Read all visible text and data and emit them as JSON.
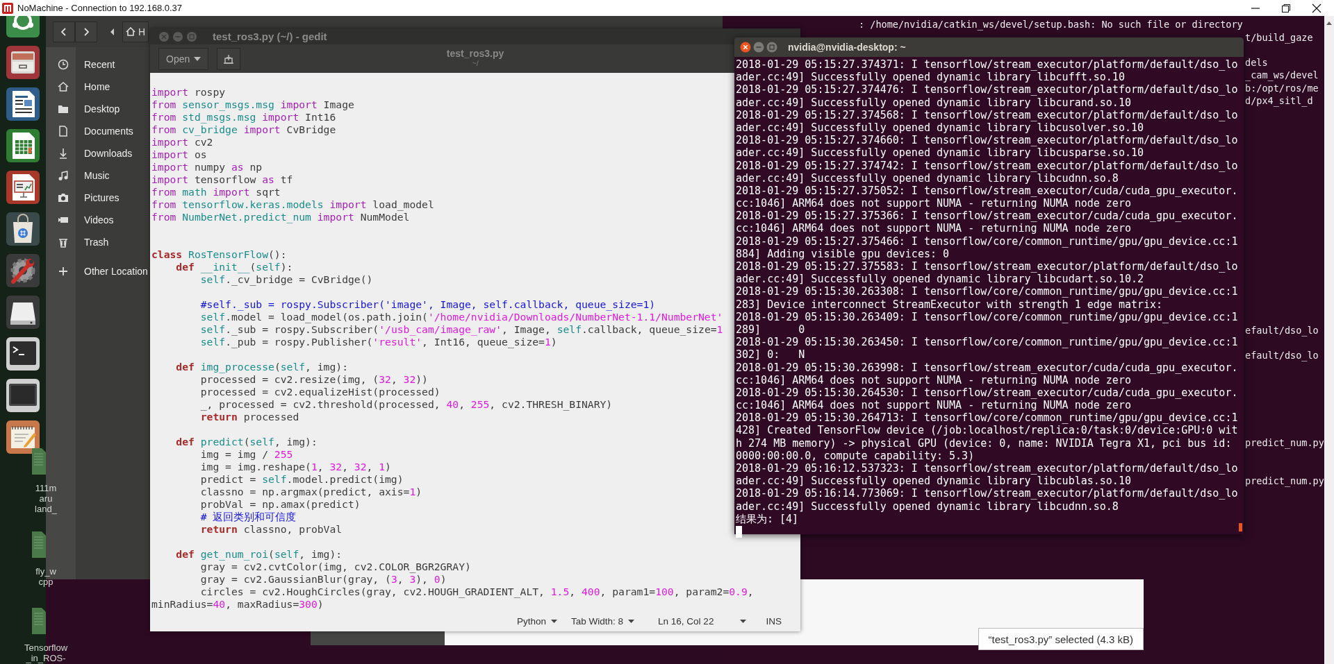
{
  "remote_window": {
    "title": "NoMachine - Connection to 192.168.0.37"
  },
  "desktop_icons": [
    {
      "lines": [
        "111m",
        "aru",
        "land_"
      ]
    },
    {
      "lines": [
        "fly_w",
        "cpp"
      ]
    },
    {
      "lines": [
        "Tensorflow",
        "_in_ROS-"
      ]
    }
  ],
  "file_manager": {
    "breadcrumb": "H",
    "places": [
      {
        "label": "Recent",
        "kind": "recent"
      },
      {
        "label": "Home",
        "kind": "home"
      },
      {
        "label": "Desktop",
        "kind": "folder"
      },
      {
        "label": "Documents",
        "kind": "document"
      },
      {
        "label": "Downloads",
        "kind": "download"
      },
      {
        "label": "Music",
        "kind": "music"
      },
      {
        "label": "Pictures",
        "kind": "camera"
      },
      {
        "label": "Videos",
        "kind": "video"
      },
      {
        "label": "Trash",
        "kind": "trash"
      },
      {
        "label": "Other Location",
        "kind": "add"
      }
    ],
    "status": "“test_ros3.py” selected (4.3 kB)"
  },
  "background_terminal": {
    "fragments": [
      ": /home/nvidia/catkin_ws/devel/setup.bash: No such file or directory",
      "t/build_gaze",
      "dels",
      "_cam_ws/devel",
      "b:/opt/ros/me",
      "d/px4_sitl_d",
      "efault/dso_lo",
      "efault/dso_lo",
      "predict_num.py",
      "predict_num.py"
    ]
  },
  "editor": {
    "window_title": "test_ros3.py (~/) - gedit",
    "open_button": "Open",
    "title": "test_ros3.py",
    "subtitle": "~/",
    "code_blocks": [
      {
        "kind": "imports",
        "lines": [
          [
            {
              "kind": "keyword",
              "text": "import "
            },
            {
              "kind": "plain",
              "text": "rospy"
            }
          ],
          [
            {
              "kind": "keyword",
              "text": "from "
            },
            {
              "kind": "name",
              "text": "sensor_msgs.msg "
            },
            {
              "kind": "keyword",
              "text": "import "
            },
            {
              "kind": "plain",
              "text": "Image"
            }
          ],
          [
            {
              "kind": "keyword",
              "text": "from "
            },
            {
              "kind": "name",
              "text": "std_msgs.msg "
            },
            {
              "kind": "keyword",
              "text": "import "
            },
            {
              "kind": "plain",
              "text": "Int16"
            }
          ],
          [
            {
              "kind": "keyword",
              "text": "from "
            },
            {
              "kind": "name",
              "text": "cv_bridge "
            },
            {
              "kind": "keyword",
              "text": "import "
            },
            {
              "kind": "plain",
              "text": "CvBridge"
            }
          ],
          [
            {
              "kind": "keyword",
              "text": "import "
            },
            {
              "kind": "plain",
              "text": "cv2"
            }
          ],
          [
            {
              "kind": "keyword",
              "text": "import "
            },
            {
              "kind": "plain",
              "text": "os"
            }
          ],
          [
            {
              "kind": "keyword",
              "text": "import "
            },
            {
              "kind": "plain",
              "text": "numpy "
            },
            {
              "kind": "keyword",
              "text": "as "
            },
            {
              "kind": "plain",
              "text": "np"
            }
          ],
          [
            {
              "kind": "keyword",
              "text": "import "
            },
            {
              "kind": "plain",
              "text": "tensorflow "
            },
            {
              "kind": "keyword",
              "text": "as "
            },
            {
              "kind": "plain",
              "text": "tf"
            }
          ],
          [
            {
              "kind": "keyword",
              "text": "from "
            },
            {
              "kind": "name",
              "text": "math "
            },
            {
              "kind": "keyword",
              "text": "import "
            },
            {
              "kind": "plain",
              "text": "sqrt"
            }
          ],
          [
            {
              "kind": "keyword",
              "text": "from "
            },
            {
              "kind": "name",
              "text": "tensorflow.keras.models "
            },
            {
              "kind": "keyword",
              "text": "import "
            },
            {
              "kind": "plain",
              "text": "load_model"
            }
          ],
          [
            {
              "kind": "keyword",
              "text": "from "
            },
            {
              "kind": "name",
              "text": "NumberNet.predict_num "
            },
            {
              "kind": "keyword",
              "text": "import "
            },
            {
              "kind": "plain",
              "text": "NumModel"
            }
          ]
        ]
      },
      {
        "kind": "class",
        "lines": [
          [
            {
              "kind": "statement",
              "text": "class "
            },
            {
              "kind": "name",
              "text": "RosTensorFlow"
            },
            {
              "kind": "plain",
              "text": "():"
            }
          ],
          [
            {
              "kind": "statement",
              "text": "    def "
            },
            {
              "kind": "name",
              "text": "__init__"
            },
            {
              "kind": "plain",
              "text": "("
            },
            {
              "kind": "name",
              "text": "self"
            },
            {
              "kind": "plain",
              "text": "):"
            }
          ],
          [
            {
              "kind": "name",
              "text": "        self"
            },
            {
              "kind": "plain",
              "text": "._cv_bridge = CvBridge()"
            }
          ]
        ]
      },
      {
        "kind": "body",
        "lines": [
          [
            {
              "kind": "comment",
              "text": "        #self._sub = rospy.Subscriber('image', Image, self.callback, queue_size=1)"
            }
          ],
          [
            {
              "kind": "name",
              "text": "        self"
            },
            {
              "kind": "plain",
              "text": ".model = load_model(os.path.join("
            },
            {
              "kind": "string",
              "text": "'/home/nvidia/Downloads/NumberNet-1.1/NumberNet'"
            }
          ],
          [
            {
              "kind": "name",
              "text": "        self"
            },
            {
              "kind": "plain",
              "text": "._sub = rospy.Subscriber("
            },
            {
              "kind": "string",
              "text": "'/usb_cam/image_raw'"
            },
            {
              "kind": "plain",
              "text": ", Image, "
            },
            {
              "kind": "name",
              "text": "self"
            },
            {
              "kind": "plain",
              "text": ".callback, queue_size="
            },
            {
              "kind": "number",
              "text": "1"
            }
          ],
          [
            {
              "kind": "name",
              "text": "        self"
            },
            {
              "kind": "plain",
              "text": "._pub = rospy.Publisher("
            },
            {
              "kind": "string",
              "text": "'result'"
            },
            {
              "kind": "plain",
              "text": ", Int16, queue_size="
            },
            {
              "kind": "number",
              "text": "1"
            },
            {
              "kind": "plain",
              "text": ")"
            }
          ]
        ]
      },
      {
        "kind": "method",
        "lines": [
          [
            {
              "kind": "statement",
              "text": "    def "
            },
            {
              "kind": "name",
              "text": "img_processe"
            },
            {
              "kind": "plain",
              "text": "("
            },
            {
              "kind": "name",
              "text": "self"
            },
            {
              "kind": "plain",
              "text": ", img):"
            }
          ],
          [
            {
              "kind": "plain",
              "text": "        processed = cv2.resize(img, ("
            },
            {
              "kind": "number",
              "text": "32"
            },
            {
              "kind": "plain",
              "text": ", "
            },
            {
              "kind": "number",
              "text": "32"
            },
            {
              "kind": "plain",
              "text": "))"
            }
          ],
          [
            {
              "kind": "plain",
              "text": "        processed = cv2.equalizeHist(processed)"
            }
          ],
          [
            {
              "kind": "plain",
              "text": "        _, processed = cv2.threshold(processed, "
            },
            {
              "kind": "number",
              "text": "40"
            },
            {
              "kind": "plain",
              "text": ", "
            },
            {
              "kind": "number",
              "text": "255"
            },
            {
              "kind": "plain",
              "text": ", cv2.THRESH_BINARY)"
            }
          ],
          [
            {
              "kind": "statement",
              "text": "        return "
            },
            {
              "kind": "plain",
              "text": "processed"
            }
          ]
        ]
      },
      {
        "kind": "method",
        "lines": [
          [
            {
              "kind": "statement",
              "text": "    def "
            },
            {
              "kind": "name",
              "text": "predict"
            },
            {
              "kind": "plain",
              "text": "("
            },
            {
              "kind": "name",
              "text": "self"
            },
            {
              "kind": "plain",
              "text": ", img):"
            }
          ],
          [
            {
              "kind": "plain",
              "text": "        img = img / "
            },
            {
              "kind": "number",
              "text": "255"
            }
          ],
          [
            {
              "kind": "plain",
              "text": "        img = img.reshape("
            },
            {
              "kind": "number",
              "text": "1"
            },
            {
              "kind": "plain",
              "text": ", "
            },
            {
              "kind": "number",
              "text": "32"
            },
            {
              "kind": "plain",
              "text": ", "
            },
            {
              "kind": "number",
              "text": "32"
            },
            {
              "kind": "plain",
              "text": ", "
            },
            {
              "kind": "number",
              "text": "1"
            },
            {
              "kind": "plain",
              "text": ")"
            }
          ],
          [
            {
              "kind": "plain",
              "text": "        predict = "
            },
            {
              "kind": "name",
              "text": "self"
            },
            {
              "kind": "plain",
              "text": ".model.predict(img)"
            }
          ],
          [
            {
              "kind": "plain",
              "text": "        classno = np.argmax(predict, axis="
            },
            {
              "kind": "number",
              "text": "1"
            },
            {
              "kind": "plain",
              "text": ")"
            }
          ],
          [
            {
              "kind": "plain",
              "text": "        probVal = np.amax(predict)"
            }
          ],
          [
            {
              "kind": "comment",
              "text": "        # 返回类别和可信度"
            }
          ],
          [
            {
              "kind": "statement",
              "text": "        return "
            },
            {
              "kind": "plain",
              "text": "classno, probVal"
            }
          ]
        ]
      },
      {
        "kind": "method",
        "lines": [
          [
            {
              "kind": "statement",
              "text": "    def "
            },
            {
              "kind": "name",
              "text": "get_num_roi"
            },
            {
              "kind": "plain",
              "text": "("
            },
            {
              "kind": "name",
              "text": "self"
            },
            {
              "kind": "plain",
              "text": ", img):"
            }
          ],
          [
            {
              "kind": "plain",
              "text": "        gray = cv2.cvtColor(img, cv2.COLOR_BGR2GRAY)"
            }
          ],
          [
            {
              "kind": "plain",
              "text": "        gray = cv2.GaussianBlur(gray, ("
            },
            {
              "kind": "number",
              "text": "3"
            },
            {
              "kind": "plain",
              "text": ", "
            },
            {
              "kind": "number",
              "text": "3"
            },
            {
              "kind": "plain",
              "text": "), "
            },
            {
              "kind": "number",
              "text": "0"
            },
            {
              "kind": "plain",
              "text": ")"
            }
          ],
          [
            {
              "kind": "plain",
              "text": "        circles = cv2.HoughCircles(gray, cv2.HOUGH_GRADIENT_ALT, "
            },
            {
              "kind": "number",
              "text": "1.5"
            },
            {
              "kind": "plain",
              "text": ", "
            },
            {
              "kind": "number",
              "text": "400"
            },
            {
              "kind": "plain",
              "text": ", param1="
            },
            {
              "kind": "number",
              "text": "100"
            },
            {
              "kind": "plain",
              "text": ", param2="
            },
            {
              "kind": "number",
              "text": "0.9"
            },
            {
              "kind": "plain",
              "text": ","
            }
          ],
          [
            {
              "kind": "plain",
              "text": "minRadius="
            },
            {
              "kind": "number",
              "text": "40"
            },
            {
              "kind": "plain",
              "text": ", maxRadius="
            },
            {
              "kind": "number",
              "text": "300"
            },
            {
              "kind": "plain",
              "text": ")"
            }
          ]
        ]
      }
    ],
    "status_bar": {
      "language": "Python",
      "tab_width": "Tab Width: 8",
      "position": "Ln 16, Col 22",
      "mode": "INS"
    }
  },
  "terminal": {
    "title": "nvidia@nvidia-desktop: ~",
    "lines": [
      "2018-01-29 05:15:27.374371: I tensorflow/stream_executor/platform/default/dso_lo",
      "ader.cc:49] Successfully opened dynamic library libcufft.so.10",
      "2018-01-29 05:15:27.374476: I tensorflow/stream_executor/platform/default/dso_lo",
      "ader.cc:49] Successfully opened dynamic library libcurand.so.10",
      "2018-01-29 05:15:27.374568: I tensorflow/stream_executor/platform/default/dso_lo",
      "ader.cc:49] Successfully opened dynamic library libcusolver.so.10",
      "2018-01-29 05:15:27.374660: I tensorflow/stream_executor/platform/default/dso_lo",
      "ader.cc:49] Successfully opened dynamic library libcusparse.so.10",
      "2018-01-29 05:15:27.374742: I tensorflow/stream_executor/platform/default/dso_lo",
      "ader.cc:49] Successfully opened dynamic library libcudnn.so.8",
      "2018-01-29 05:15:27.375052: I tensorflow/stream_executor/cuda/cuda_gpu_executor.",
      "cc:1046] ARM64 does not support NUMA - returning NUMA node zero",
      "2018-01-29 05:15:27.375366: I tensorflow/stream_executor/cuda/cuda_gpu_executor.",
      "cc:1046] ARM64 does not support NUMA - returning NUMA node zero",
      "2018-01-29 05:15:27.375466: I tensorflow/core/common_runtime/gpu/gpu_device.cc:1",
      "884] Adding visible gpu devices: 0",
      "2018-01-29 05:15:27.375583: I tensorflow/stream_executor/platform/default/dso_lo",
      "ader.cc:49] Successfully opened dynamic library libcudart.so.10.2",
      "2018-01-29 05:15:30.263308: I tensorflow/core/common_runtime/gpu/gpu_device.cc:1",
      "283] Device interconnect StreamExecutor with strength 1 edge matrix:",
      "2018-01-29 05:15:30.263409: I tensorflow/core/common_runtime/gpu/gpu_device.cc:1",
      "289]      0",
      "2018-01-29 05:15:30.263450: I tensorflow/core/common_runtime/gpu/gpu_device.cc:1",
      "302] 0:   N",
      "2018-01-29 05:15:30.263998: I tensorflow/stream_executor/cuda/cuda_gpu_executor.",
      "cc:1046] ARM64 does not support NUMA - returning NUMA node zero",
      "2018-01-29 05:15:30.264530: I tensorflow/stream_executor/cuda/cuda_gpu_executor.",
      "cc:1046] ARM64 does not support NUMA - returning NUMA node zero",
      "2018-01-29 05:15:30.264713: I tensorflow/core/common_runtime/gpu/gpu_device.cc:1",
      "428] Created TensorFlow device (/job:localhost/replica:0/task:0/device:GPU:0 wit",
      "h 274 MB memory) -> physical GPU (device: 0, name: NVIDIA Tegra X1, pci bus id:",
      "0000:00:00.0, compute capability: 5.3)",
      "2018-01-29 05:16:12.537323: I tensorflow/stream_executor/platform/default/dso_lo",
      "ader.cc:49] Successfully opened dynamic library libcublas.so.10",
      "2018-01-29 05:16:14.773069: I tensorflow/stream_executor/platform/default/dso_lo",
      "ader.cc:49] Successfully opened dynamic library libcudnn.so.8",
      "结果为: [4]"
    ]
  }
}
